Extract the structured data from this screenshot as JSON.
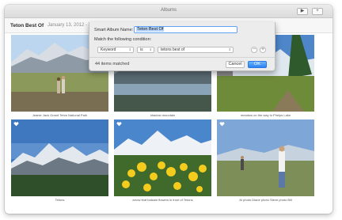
{
  "window": {
    "title": "Albums",
    "play_icon": "play-icon",
    "add_icon": "plus-icon"
  },
  "subheader": {
    "album_name": "Teton Best Of",
    "date_range": "January 13, 2012 - June"
  },
  "photos": [
    {
      "caption": "Jeanie Jack Grand Teton National Park"
    },
    {
      "caption": "shadow mountain"
    },
    {
      "caption": "meadow on the way to Phelps Lake"
    },
    {
      "caption": "Tetons"
    },
    {
      "caption": "arrow feaf balsam flowers in front of Tetons"
    },
    {
      "caption": "AI photo Diane photo Steve photo Bill"
    }
  ],
  "dialog": {
    "name_label": "Smart Album Name:",
    "name_value": "Teton Best Of",
    "condition_label": "Match the following condition:",
    "rule": {
      "field": "Keyword",
      "operator": "is",
      "value": "tetons best of",
      "remove_symbol": "−",
      "add_symbol": "+"
    },
    "matched": "44 items matched",
    "cancel_label": "Cancel",
    "ok_label": "OK"
  },
  "colors": {
    "accent": "#2b82f5",
    "focus_ring": "#5ea3f5"
  }
}
